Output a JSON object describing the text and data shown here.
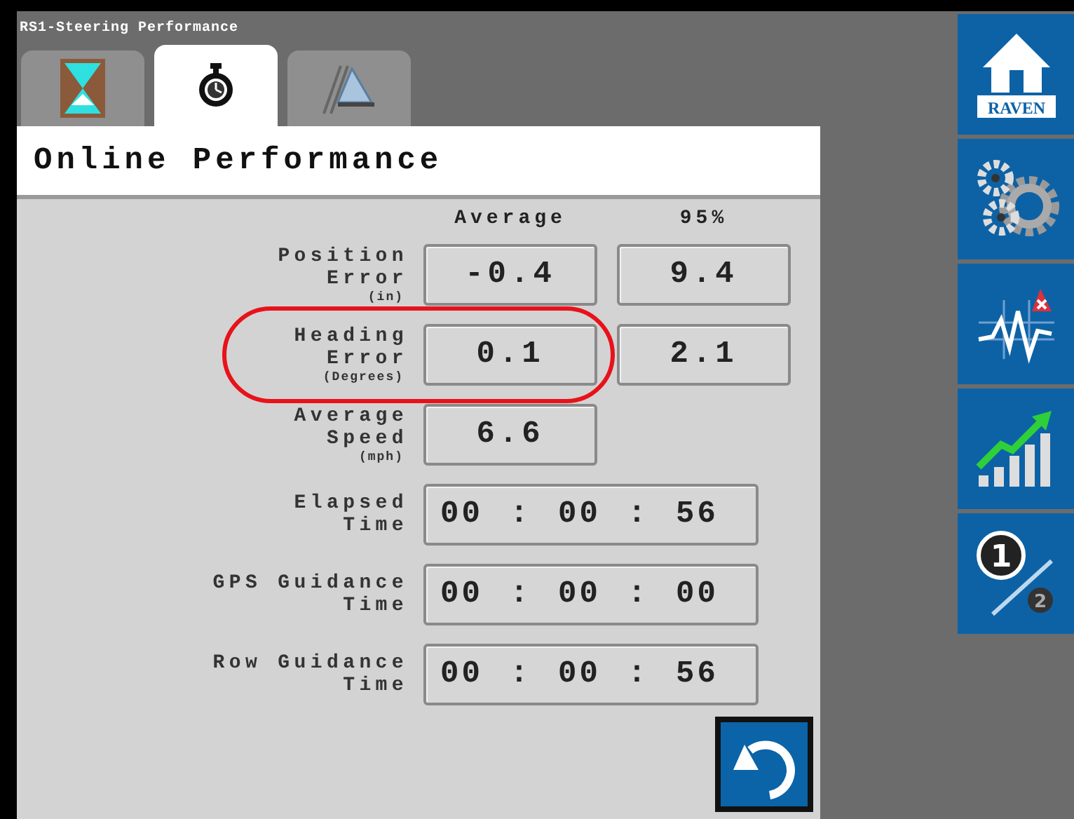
{
  "window": {
    "title": "RS1-Steering Performance"
  },
  "tabs": [
    {
      "kind": "hourglass",
      "selected": false
    },
    {
      "kind": "stopwatch",
      "selected": true
    },
    {
      "kind": "ruler",
      "selected": false
    }
  ],
  "header": {
    "title": "Online Performance"
  },
  "columns": [
    "Average",
    "95%"
  ],
  "rows": [
    {
      "kind": "pair",
      "label": [
        "Position",
        "Error"
      ],
      "unit": "(in)",
      "values": [
        "-0.4",
        "9.4"
      ],
      "highlighted": false
    },
    {
      "kind": "pair",
      "label": [
        "Heading",
        "Error"
      ],
      "unit": "(Degrees)",
      "values": [
        "0.1",
        "2.1"
      ],
      "highlighted": true
    },
    {
      "kind": "pair",
      "label": [
        "Average",
        "Speed"
      ],
      "unit": "(mph)",
      "values": [
        "6.6"
      ],
      "highlighted": false
    },
    {
      "kind": "time",
      "label": [
        "Elapsed",
        "Time"
      ],
      "values": [
        "00 : 00 : 56"
      ],
      "highlighted": false
    },
    {
      "kind": "time",
      "label": [
        "GPS Guidance",
        "Time"
      ],
      "values": [
        "00 : 00 : 00"
      ],
      "highlighted": false
    },
    {
      "kind": "time",
      "label": [
        "Row Guidance",
        "Time"
      ],
      "values": [
        "00 : 00 : 56"
      ],
      "highlighted": false
    }
  ],
  "sidebar": {
    "items": [
      {
        "kind": "home",
        "label": "RAVEN"
      },
      {
        "kind": "gears"
      },
      {
        "kind": "alarm"
      },
      {
        "kind": "trend"
      },
      {
        "kind": "fraction",
        "numerator": "1",
        "denominator": "2"
      }
    ]
  }
}
